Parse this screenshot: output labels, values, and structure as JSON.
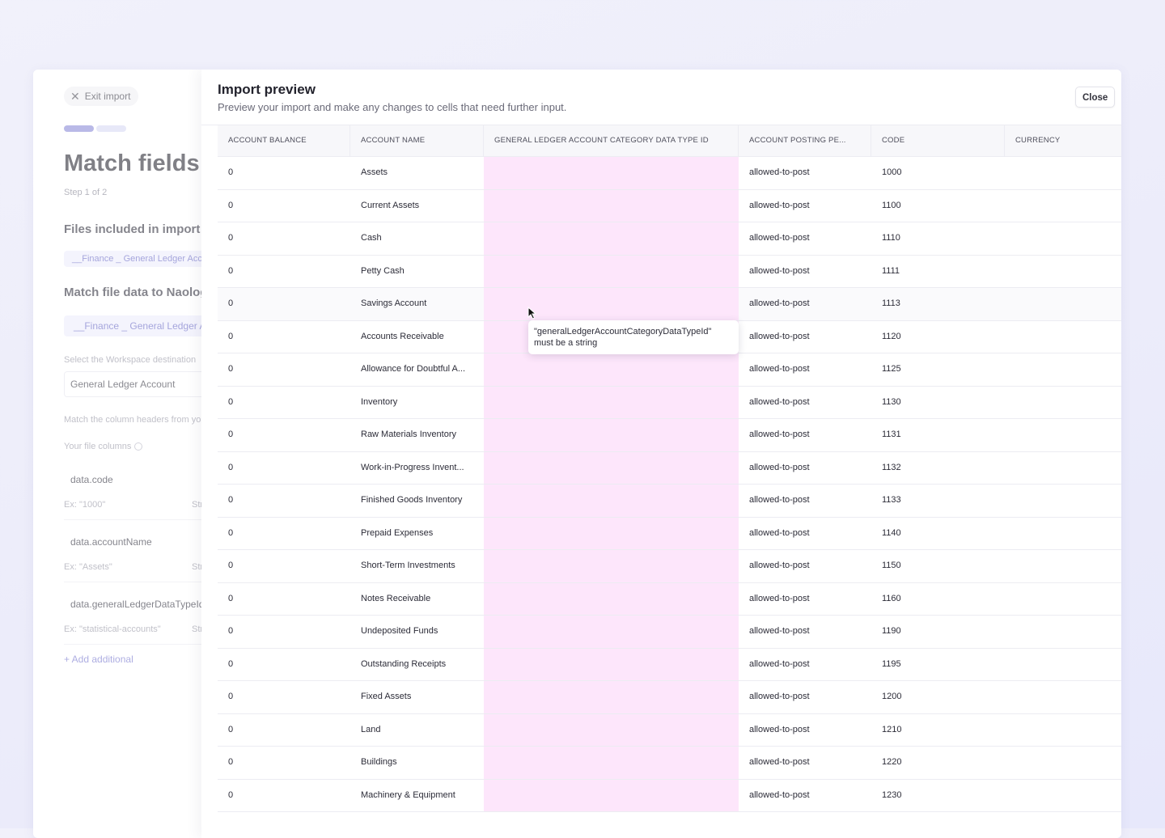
{
  "left_panel": {
    "exit_label": "Exit import",
    "title": "Match fields",
    "step": "Step 1 of 2",
    "files_heading": "Files included in import",
    "file_chip": "__Finance _ General Ledger Account",
    "match_heading": "Match file data to Naologic",
    "match_chip": "__Finance _ General Ledger Account",
    "workspace_label": "Select the Workspace destination",
    "workspace_value": "General Ledger Account",
    "headers_label": "Match the column headers from your file",
    "your_columns_label": "Your file columns",
    "fields": [
      {
        "name": "data.code",
        "example": "Ex: \"1000\"",
        "type": "String"
      },
      {
        "name": "data.accountName",
        "example": "Ex: \"Assets\"",
        "type": "String"
      },
      {
        "name": "data.generalLedgerDataTypeId",
        "example": "Ex: \"statistical-accounts\"",
        "type": "String"
      }
    ],
    "add_label": "+ Add additional"
  },
  "preview": {
    "title": "Import preview",
    "subtitle": "Preview your import and make any changes to cells that need further input.",
    "close_label": "Close",
    "columns": [
      "ACCOUNT BALANCE",
      "ACCOUNT NAME",
      "GENERAL LEDGER ACCOUNT CATEGORY DATA TYPE ID",
      "ACCOUNT POSTING PE...",
      "CODE",
      "CURRENCY"
    ],
    "rows": [
      {
        "balance": "0",
        "name": "Assets",
        "category": "",
        "posting": "allowed-to-post",
        "code": "1000",
        "currency": ""
      },
      {
        "balance": "0",
        "name": "Current Assets",
        "category": "",
        "posting": "allowed-to-post",
        "code": "1100",
        "currency": ""
      },
      {
        "balance": "0",
        "name": "Cash",
        "category": "",
        "posting": "allowed-to-post",
        "code": "1110",
        "currency": ""
      },
      {
        "balance": "0",
        "name": "Petty Cash",
        "category": "",
        "posting": "allowed-to-post",
        "code": "1111",
        "currency": ""
      },
      {
        "balance": "0",
        "name": "Savings Account",
        "category": "",
        "posting": "allowed-to-post",
        "code": "1113",
        "currency": ""
      },
      {
        "balance": "0",
        "name": "Accounts Receivable",
        "category": "",
        "posting": "allowed-to-post",
        "code": "1120",
        "currency": ""
      },
      {
        "balance": "0",
        "name": "Allowance for Doubtful A...",
        "category": "",
        "posting": "allowed-to-post",
        "code": "1125",
        "currency": ""
      },
      {
        "balance": "0",
        "name": "Inventory",
        "category": "",
        "posting": "allowed-to-post",
        "code": "1130",
        "currency": ""
      },
      {
        "balance": "0",
        "name": "Raw Materials Inventory",
        "category": "",
        "posting": "allowed-to-post",
        "code": "1131",
        "currency": ""
      },
      {
        "balance": "0",
        "name": "Work-in-Progress Invent...",
        "category": "",
        "posting": "allowed-to-post",
        "code": "1132",
        "currency": ""
      },
      {
        "balance": "0",
        "name": "Finished Goods Inventory",
        "category": "",
        "posting": "allowed-to-post",
        "code": "1133",
        "currency": ""
      },
      {
        "balance": "0",
        "name": "Prepaid Expenses",
        "category": "",
        "posting": "allowed-to-post",
        "code": "1140",
        "currency": ""
      },
      {
        "balance": "0",
        "name": "Short-Term Investments",
        "category": "",
        "posting": "allowed-to-post",
        "code": "1150",
        "currency": ""
      },
      {
        "balance": "0",
        "name": "Notes Receivable",
        "category": "",
        "posting": "allowed-to-post",
        "code": "1160",
        "currency": ""
      },
      {
        "balance": "0",
        "name": "Undeposited Funds",
        "category": "",
        "posting": "allowed-to-post",
        "code": "1190",
        "currency": ""
      },
      {
        "balance": "0",
        "name": "Outstanding Receipts",
        "category": "",
        "posting": "allowed-to-post",
        "code": "1195",
        "currency": ""
      },
      {
        "balance": "0",
        "name": "Fixed Assets",
        "category": "",
        "posting": "allowed-to-post",
        "code": "1200",
        "currency": ""
      },
      {
        "balance": "0",
        "name": "Land",
        "category": "",
        "posting": "allowed-to-post",
        "code": "1210",
        "currency": ""
      },
      {
        "balance": "0",
        "name": "Buildings",
        "category": "",
        "posting": "allowed-to-post",
        "code": "1220",
        "currency": ""
      },
      {
        "balance": "0",
        "name": "Machinery & Equipment",
        "category": "",
        "posting": "allowed-to-post",
        "code": "1230",
        "currency": ""
      }
    ],
    "tooltip": "\"generalLedgerAccountCategoryDataTypeId\" must be a string",
    "error_color": "#fde6fb",
    "accent_color": "#8f8fd9"
  }
}
